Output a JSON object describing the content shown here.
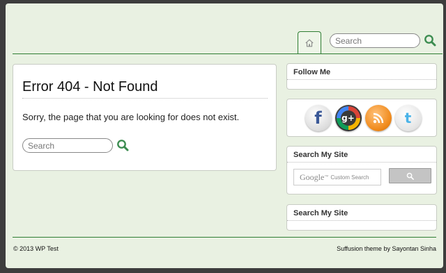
{
  "header": {
    "search_placeholder": "Search",
    "home_icon": "home-icon",
    "search_icon": "search-icon"
  },
  "main": {
    "title": "Error 404 - Not Found",
    "message": "Sorry, the page that you are looking for does not exist.",
    "search_placeholder": "Search"
  },
  "sidebar": {
    "follow_title": "Follow Me",
    "social": [
      {
        "name": "facebook-icon",
        "glyph": "f"
      },
      {
        "name": "google-plus-icon",
        "glyph": "g+"
      },
      {
        "name": "rss-icon",
        "glyph": "rss"
      },
      {
        "name": "twitter-icon",
        "glyph": "t"
      }
    ],
    "search_widget_1_title": "Search My Site",
    "google_word": "Google",
    "google_tm": "™",
    "google_custom": "Custom Search",
    "search_widget_2_title": "Search My Site"
  },
  "footer": {
    "copyright": "© 2013 WP Test",
    "theme_credit": "Suffusion theme by Sayontan Sinha"
  },
  "colors": {
    "page_bg": "#e9f1e2",
    "accent_green": "#2e7d32",
    "search_icon_green": "#3c8c50"
  }
}
